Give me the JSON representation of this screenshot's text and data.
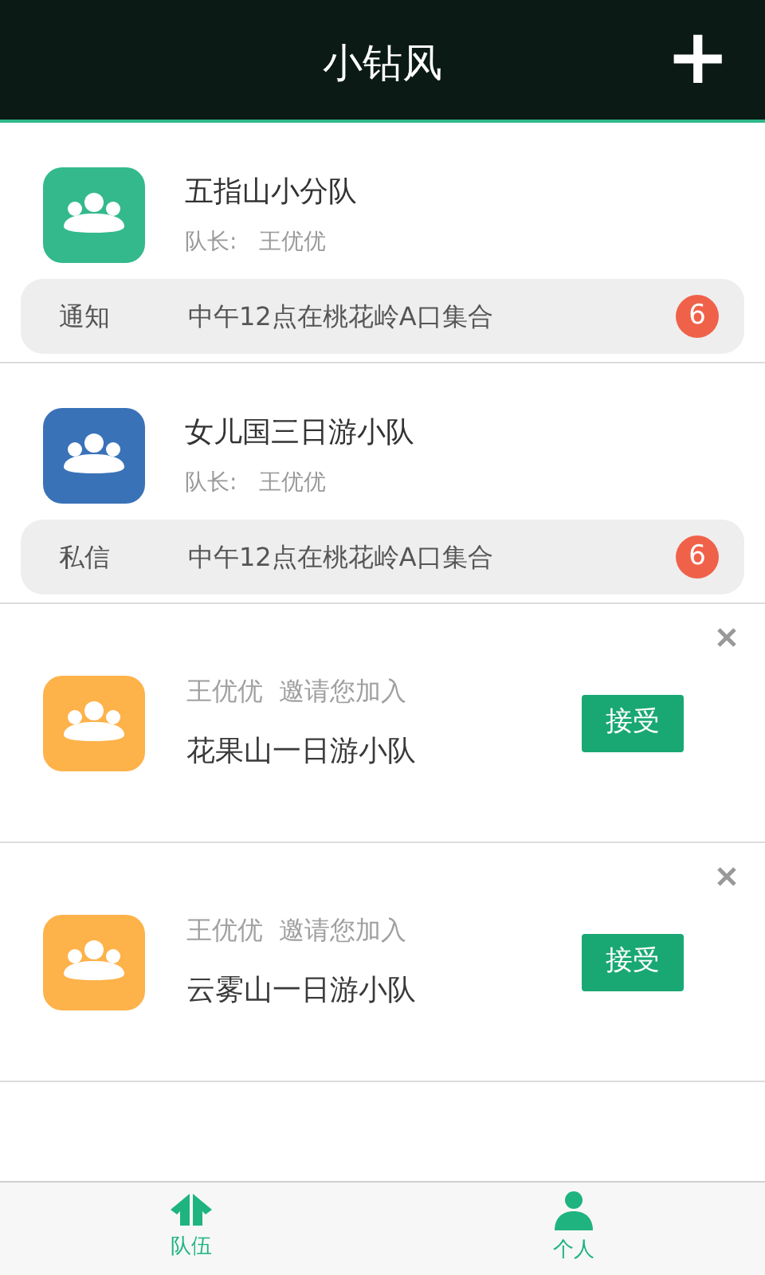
{
  "header": {
    "title": "小钻风",
    "add_button": "+"
  },
  "teams": [
    {
      "name": "五指山小分队",
      "leader_label": "队长:",
      "leader": "王优优",
      "color": "#34b98c",
      "message": {
        "tag": "通知",
        "text": "中午12点在桃花岭A口集合",
        "count": "6"
      }
    },
    {
      "name": "女儿国三日游小队",
      "leader_label": "队长:",
      "leader": "王优优",
      "color": "#3a72b8",
      "message": {
        "tag": "私信",
        "text": "中午12点在桃花岭A口集合",
        "count": "6"
      }
    }
  ],
  "invitations": [
    {
      "inviter": "王优优",
      "action": "邀请您加入",
      "team": "花果山一日游小队",
      "color": "#fdb24a",
      "accept": "接受"
    },
    {
      "inviter": "王优优",
      "action": "邀请您加入",
      "team": "云雾山一日游小队",
      "color": "#fdb24a",
      "accept": "接受"
    }
  ],
  "tab_bar": [
    {
      "label": "队伍",
      "kind": "team"
    },
    {
      "label": "个人",
      "kind": "person"
    }
  ]
}
